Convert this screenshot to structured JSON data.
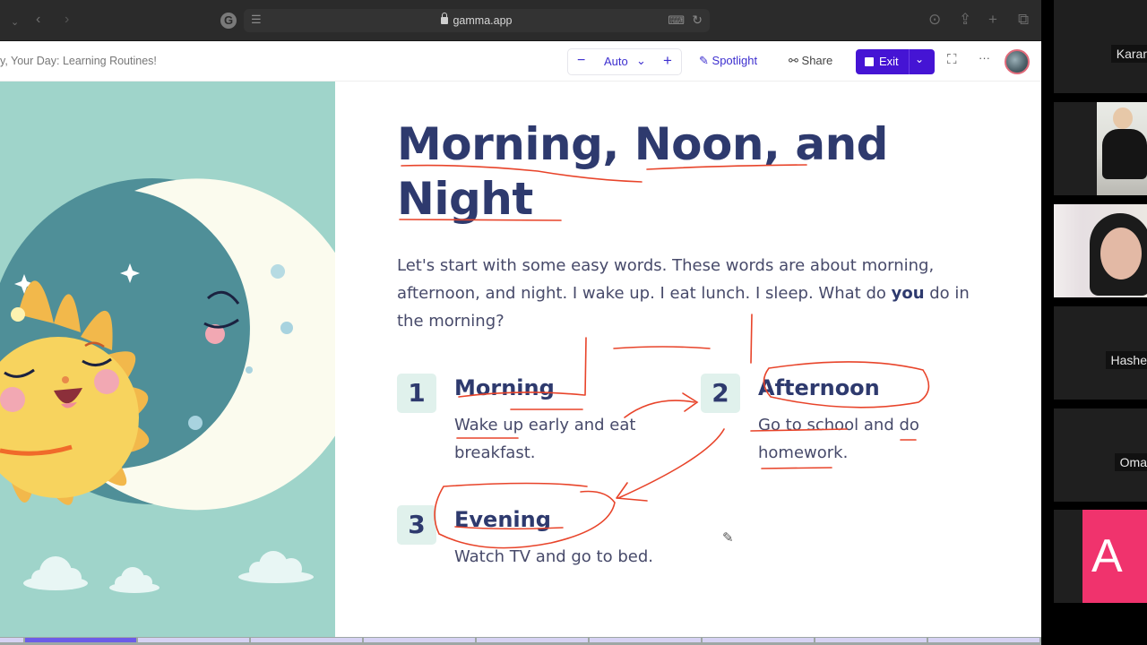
{
  "browser": {
    "url": "gamma.app",
    "icons": [
      "sidebar-toggle-icon",
      "back-icon",
      "forward-icon",
      "grammarly-icon",
      "reader-icon",
      "translate-icon",
      "reload-icon",
      "download-icon",
      "share-icon",
      "new-tab-icon",
      "tabs-overview-icon"
    ]
  },
  "header": {
    "doc_title": "y, Your Day: Learning Routines!",
    "zoom_minus": "−",
    "zoom_value": "Auto",
    "zoom_plus": "+",
    "spotlight_label": "Spotlight",
    "share_label": "Share",
    "exit_label": "Exit",
    "accent_color": "#4514d4"
  },
  "slide": {
    "title": "Morning, Noon, and Night",
    "intro_before": " Let's start with some easy words. These words are about morning, afternoon, and night. I wake up. I eat lunch. I sleep. What do ",
    "intro_bold": "you",
    "intro_after": " do in the morning?",
    "steps": [
      {
        "number": "1",
        "heading": "Morning",
        "description": "Wake up early and eat breakfast."
      },
      {
        "number": "2",
        "heading": "Afternoon",
        "description": "Go to school and do homework."
      },
      {
        "number": "3",
        "heading": "Evening",
        "description": "Watch TV and go to bed."
      }
    ],
    "illustration": "sleeping-sun-and-moon",
    "ink_color": "#e8442a"
  },
  "progress": {
    "total_segments": 10,
    "current_segment": 2
  },
  "participants": [
    {
      "name": "Karar",
      "video": false
    },
    {
      "name": "",
      "video": true
    },
    {
      "name": "",
      "video": true
    },
    {
      "name": "Hashe",
      "video": false
    },
    {
      "name": "Oma",
      "video": false
    },
    {
      "name": "A",
      "video": false,
      "avatar_color": "#f0336d"
    }
  ]
}
